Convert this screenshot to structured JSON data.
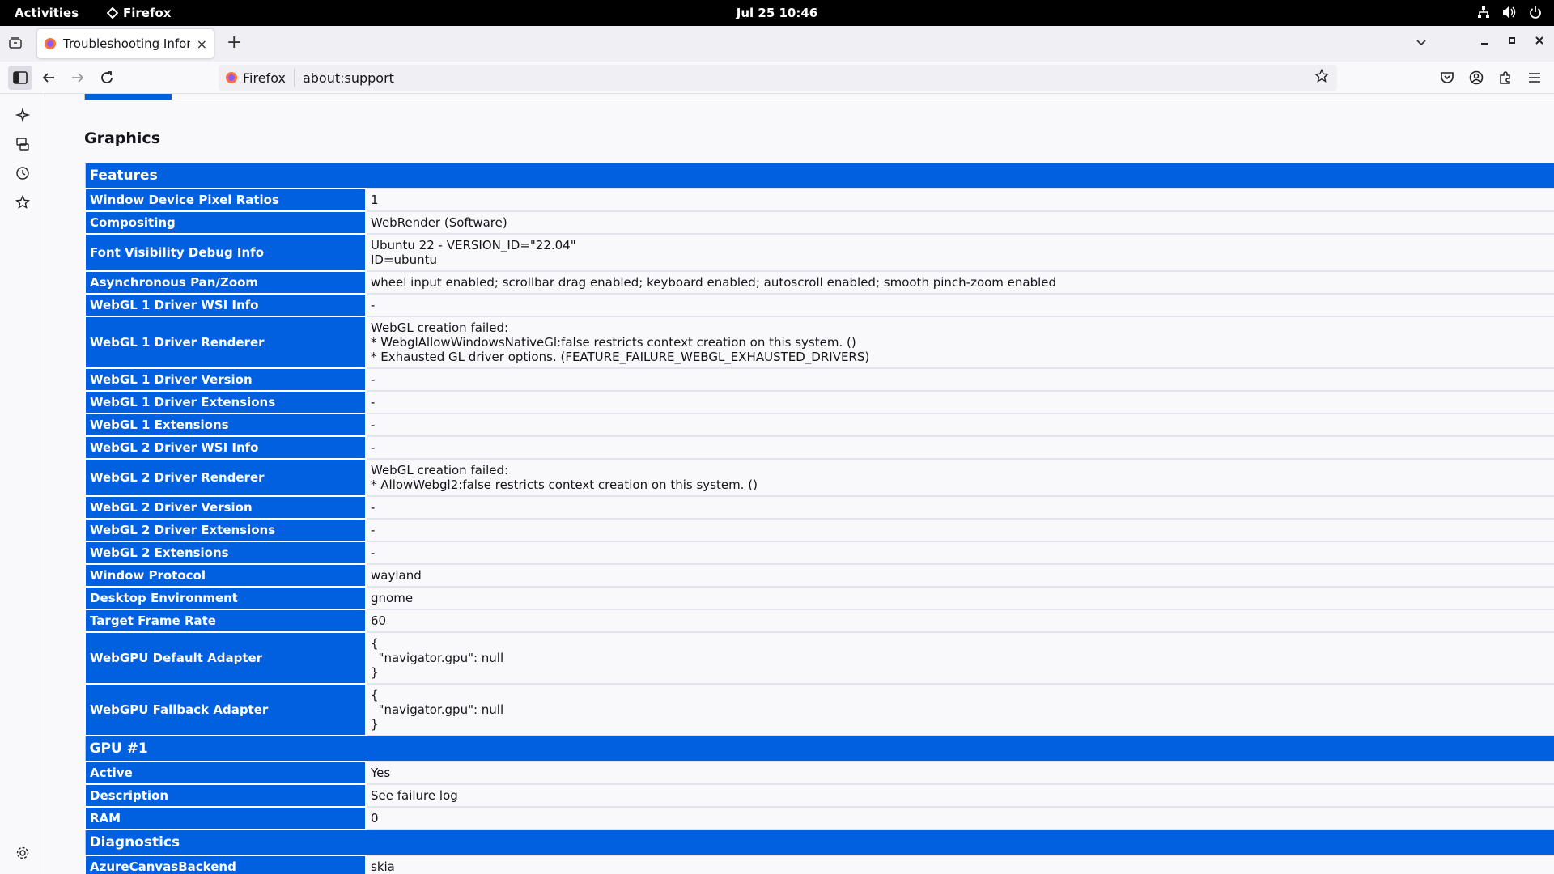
{
  "topbar": {
    "activities": "Activities",
    "app_name": "Firefox",
    "clock": "Jul 25  10:46"
  },
  "tabs": [
    {
      "title": "Troubleshooting Inform",
      "close": "×"
    }
  ],
  "newtab": "+",
  "urlbar": {
    "identity": "Firefox",
    "url": "about:support"
  },
  "page": {
    "section_title": "Graphics",
    "features_header": "Features",
    "features": [
      {
        "key": "Window Device Pixel Ratios",
        "value": "1"
      },
      {
        "key": "Compositing",
        "value": "WebRender (Software)"
      },
      {
        "key": "Font Visibility Debug Info",
        "value": "Ubuntu 22 - VERSION_ID=\"22.04\"\nID=ubuntu"
      },
      {
        "key": "Asynchronous Pan/Zoom",
        "value": "wheel input enabled; scrollbar drag enabled; keyboard enabled; autoscroll enabled; smooth pinch-zoom enabled"
      },
      {
        "key": "WebGL 1 Driver WSI Info",
        "value": "-"
      },
      {
        "key": "WebGL 1 Driver Renderer",
        "value": "WebGL creation failed:\n* WebglAllowWindowsNativeGl:false restricts context creation on this system. ()\n* Exhausted GL driver options. (FEATURE_FAILURE_WEBGL_EXHAUSTED_DRIVERS)"
      },
      {
        "key": "WebGL 1 Driver Version",
        "value": "-"
      },
      {
        "key": "WebGL 1 Driver Extensions",
        "value": "-"
      },
      {
        "key": "WebGL 1 Extensions",
        "value": "-"
      },
      {
        "key": "WebGL 2 Driver WSI Info",
        "value": "-"
      },
      {
        "key": "WebGL 2 Driver Renderer",
        "value": "WebGL creation failed:\n* AllowWebgl2:false restricts context creation on this system. ()"
      },
      {
        "key": "WebGL 2 Driver Version",
        "value": "-"
      },
      {
        "key": "WebGL 2 Driver Extensions",
        "value": "-"
      },
      {
        "key": "WebGL 2 Extensions",
        "value": "-"
      },
      {
        "key": "Window Protocol",
        "value": "wayland"
      },
      {
        "key": "Desktop Environment",
        "value": "gnome"
      },
      {
        "key": "Target Frame Rate",
        "value": "60"
      },
      {
        "key": "WebGPU Default Adapter",
        "value": "{\n  \"navigator.gpu\": null\n}"
      },
      {
        "key": "WebGPU Fallback Adapter",
        "value": "{\n  \"navigator.gpu\": null\n}"
      }
    ],
    "gpu_header": "GPU #1",
    "gpu": [
      {
        "key": "Active",
        "value": "Yes"
      },
      {
        "key": "Description",
        "value": "See failure log"
      },
      {
        "key": "RAM",
        "value": "0"
      }
    ],
    "diagnostics_header": "Diagnostics",
    "diagnostics": [
      {
        "key": "AzureCanvasBackend",
        "value": "skia"
      }
    ]
  },
  "colors": {
    "accent": "#0060df",
    "topbar": "#000000",
    "tabstrip": "#f0f0f4"
  },
  "icons": {
    "sidebar": [
      "ai-sparkle-icon",
      "synced-tabs-icon",
      "history-icon",
      "bookmarks-star-icon",
      "settings-gear-icon"
    ]
  }
}
